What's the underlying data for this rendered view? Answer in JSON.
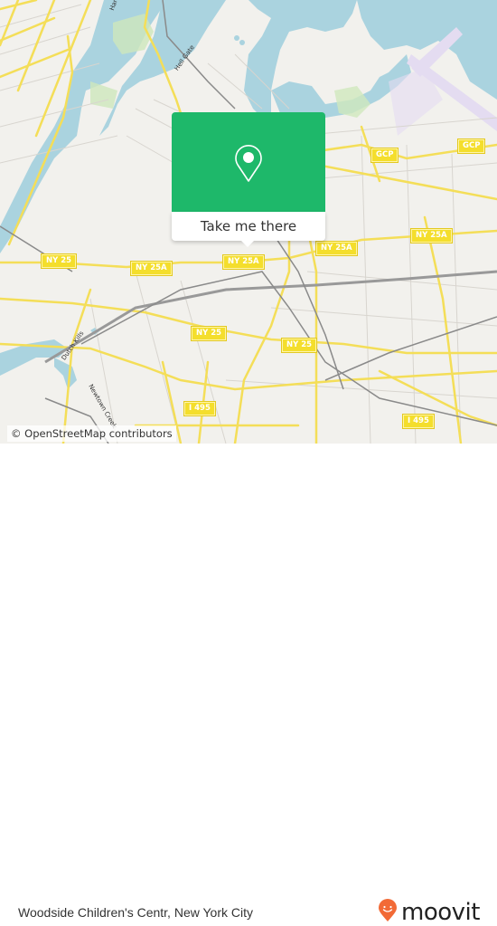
{
  "map": {
    "attribution": "© OpenStreetMap contributors",
    "water_labels": [
      "Harlem",
      "Hell Gate",
      "Dutch Kills",
      "Newtown Creek"
    ],
    "shields": [
      {
        "text": "GCP"
      },
      {
        "text": "GCP"
      },
      {
        "text": "NY 25A"
      },
      {
        "text": "NY 25A"
      },
      {
        "text": "NY 25A"
      },
      {
        "text": "NY 25A"
      },
      {
        "text": "NY 25"
      },
      {
        "text": "NY 25"
      },
      {
        "text": "NY 25"
      },
      {
        "text": "I 495"
      },
      {
        "text": "I 495"
      }
    ],
    "colors": {
      "land": "#f2f1ed",
      "water": "#aad3df",
      "road": "#f7e26b",
      "rail": "#777777",
      "park": "#c8e6b0",
      "airport": "#e5dff0"
    }
  },
  "popup": {
    "action_label": "Take me there",
    "icon": "map-pin-icon",
    "color": "#1eb86a"
  },
  "footer": {
    "place_name": "Woodside Children's Centr, New York City",
    "brand": "moovit",
    "brand_color": "#f26a36"
  }
}
